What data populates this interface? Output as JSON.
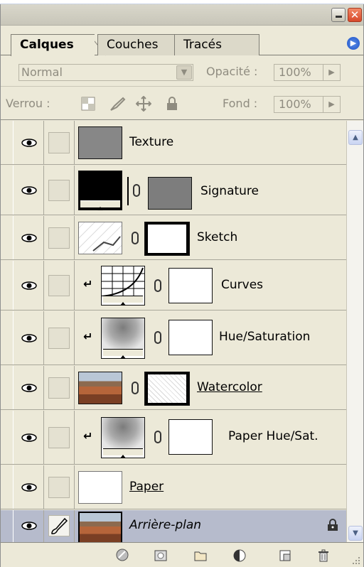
{
  "tabs": [
    {
      "label": "Calques",
      "active": true
    },
    {
      "label": "Couches",
      "active": false
    },
    {
      "label": "Tracés",
      "active": false
    }
  ],
  "options": {
    "blend_mode": "Normal",
    "opacity_label": "Opacité :",
    "opacity_value": "100%",
    "lock_label": "Verrou :",
    "fill_label": "Fond :",
    "fill_value": "100%"
  },
  "layers": [
    {
      "name": "Texture",
      "visible": true,
      "clipped": false,
      "has_mask": false,
      "thumb": "grey"
    },
    {
      "name": "Signature",
      "visible": true,
      "clipped": false,
      "has_mask": true,
      "thumb": "black-adjust"
    },
    {
      "name": "Sketch",
      "visible": true,
      "clipped": false,
      "has_mask": true,
      "thumb": "sketch"
    },
    {
      "name": "Curves",
      "visible": true,
      "clipped": true,
      "has_mask": true,
      "thumb": "curves-adjust"
    },
    {
      "name": "Hue/Saturation",
      "visible": true,
      "clipped": true,
      "has_mask": true,
      "thumb": "huesat-adjust"
    },
    {
      "name": "Watercolor",
      "visible": true,
      "clipped": false,
      "has_mask": true,
      "thumb": "photo",
      "underlined": true
    },
    {
      "name": "Paper Hue/Sat.",
      "visible": true,
      "clipped": true,
      "has_mask": true,
      "thumb": "huesat-adjust"
    },
    {
      "name": "Paper",
      "visible": true,
      "clipped": false,
      "has_mask": false,
      "thumb": "white",
      "underlined": true
    },
    {
      "name": "Arrière-plan",
      "visible": true,
      "clipped": false,
      "has_mask": false,
      "thumb": "photo",
      "italic": true,
      "locked": true,
      "selected": true
    }
  ],
  "footer_icons": [
    "link-layers-icon",
    "layer-style-icon",
    "add-mask-icon",
    "new-group-icon",
    "adjustment-layer-icon",
    "new-layer-icon",
    "trash-icon"
  ],
  "colors": {
    "panel": "#ece9d8",
    "selected_row": "#b6bbcc",
    "close_button": "#d7482a",
    "menu_arrow": "#1d52c9"
  }
}
